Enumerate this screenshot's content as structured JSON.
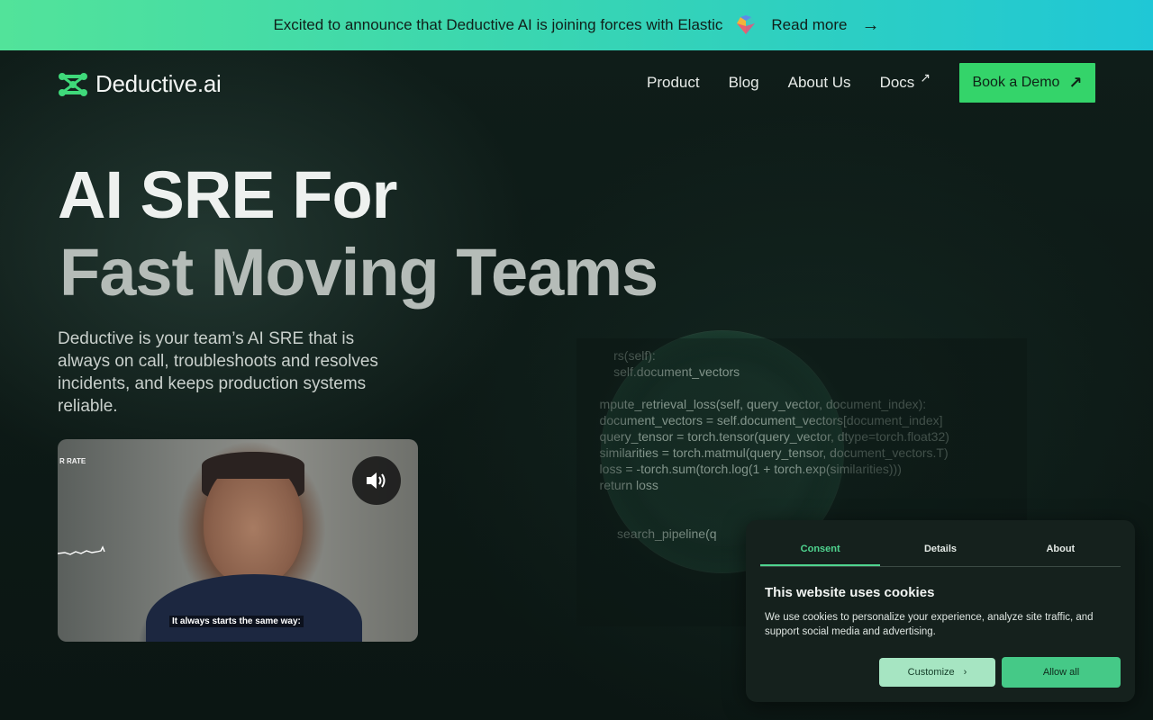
{
  "banner": {
    "text": "Excited to announce that Deductive AI is joining forces with Elastic",
    "link_label": "Read more",
    "arrow": "→"
  },
  "header": {
    "brand": "Deductive.ai",
    "nav": [
      "Product",
      "Blog",
      "About Us",
      "Docs"
    ],
    "docs_external": "↗",
    "cta_label": "Book a Demo",
    "cta_icon": "↗"
  },
  "hero": {
    "title_line1": "AI SRE For",
    "title_line2": "Fast Moving Teams",
    "subtitle": "Deductive is your team’s AI SRE that is always on call, troubleshoots and resolves incidents, and keeps production systems reliable."
  },
  "video": {
    "overlay_text": "R RATE",
    "caption": "It always starts the same way:"
  },
  "code_lines": [
    "        rs(self):",
    "        self.document_vectors",
    "",
    "    mpute_retrieval_loss(self, query_vector, document_index):",
    "    document_vectors = self.document_vectors[document_index]",
    "    query_tensor = torch.tensor(query_vector, dtype=torch.float32)",
    "    similarities = torch.matmul(query_tensor, document_vectors.T)",
    "    loss = -torch.sum(torch.log(1 + torch.exp(similarities)))",
    "    return loss",
    "",
    "",
    "         search_pipeline(q"
  ],
  "cookie": {
    "tabs": [
      "Consent",
      "Details",
      "About"
    ],
    "title": "This website uses cookies",
    "description": "We use cookies to personalize your experience, analyze site traffic, and support social media and advertising.",
    "customize_label": "Customize",
    "allow_label": "Allow all"
  },
  "colors": {
    "accent_green": "#34d46a",
    "banner_start": "#52e39a",
    "banner_end": "#1fc7d6",
    "background": "#0c1714"
  }
}
